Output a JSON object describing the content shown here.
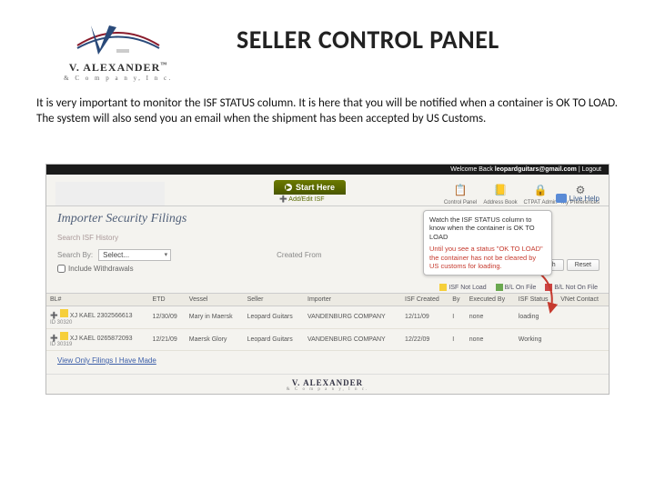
{
  "logo": {
    "brand": "V. ALEXANDER",
    "sub": "& C o m p a n y, I n c.",
    "tm": "™"
  },
  "title": "SELLER CONTROL PANEL",
  "body": "It is very important to monitor the ISF STATUS column. It is here that you will be notified when a container is OK TO LOAD. The system will also send you an email when the shipment has been accepted by US Customs.",
  "shot": {
    "welcome_prefix": "Welcome Back",
    "welcome_user": "leopardguitars@gmail.com",
    "welcome_sep": " | ",
    "logout": "Logout",
    "start_here": "Start Here",
    "add_edit": "Add/Edit ISF",
    "nav": [
      {
        "label": "Control Panel",
        "icon": "📋"
      },
      {
        "label": "Address Book",
        "icon": "📒"
      },
      {
        "label": "CTPAT Admin",
        "icon": "🔒"
      },
      {
        "label": "My Preferences",
        "icon": "⚙"
      }
    ],
    "page_title": "Importer Security Filings",
    "live_help": "Live Help",
    "search_label": "Search ISF History",
    "search_by": "Search By:",
    "search_select": "Select...",
    "created_from": "Created From",
    "include_withdrawals": "Include Withdrawals",
    "btn_search": "Search",
    "btn_reset": "Reset",
    "callout1": "Watch the ISF STATUS column to know when the container is OK TO LOAD",
    "callout2": "Until you see a status \"OK TO LOAD\" the container has not be cleared by US customs for loading.",
    "legend": {
      "not_on_file": "ISF Not Load",
      "on_file": "B/L On File",
      "not_bl": "B/L Not On File"
    },
    "columns": [
      "BL#",
      "ETD",
      "Vessel",
      "Seller",
      "Importer",
      "ISF Created",
      "By",
      "Executed By",
      "ISF Status",
      "VNet Contact"
    ],
    "rows": [
      {
        "bl": "XJ KAEL 2302566613",
        "id": "ID 30320",
        "etd": "12/30/09",
        "vessel": "Mary in Maersk",
        "seller": "Leopard Guitars",
        "importer": "VANDENBURG COMPANY",
        "created": "12/11/09",
        "by": "I",
        "exec": "none",
        "status": "loading",
        "vnet": ""
      },
      {
        "bl": "XJ KAEL 0265872093",
        "id": "ID 30319",
        "etd": "12/21/09",
        "vessel": "Maersk Glory",
        "seller": "Leopard Guitars",
        "importer": "VANDENBURG COMPANY",
        "created": "12/22/09",
        "by": "I",
        "exec": "none",
        "status": "Working",
        "vnet": ""
      }
    ],
    "foot_link": "View Only Filings I Have Made",
    "footer_brand": "V. ALEXANDER",
    "footer_sub": "& C o m p a n y, I n c."
  }
}
